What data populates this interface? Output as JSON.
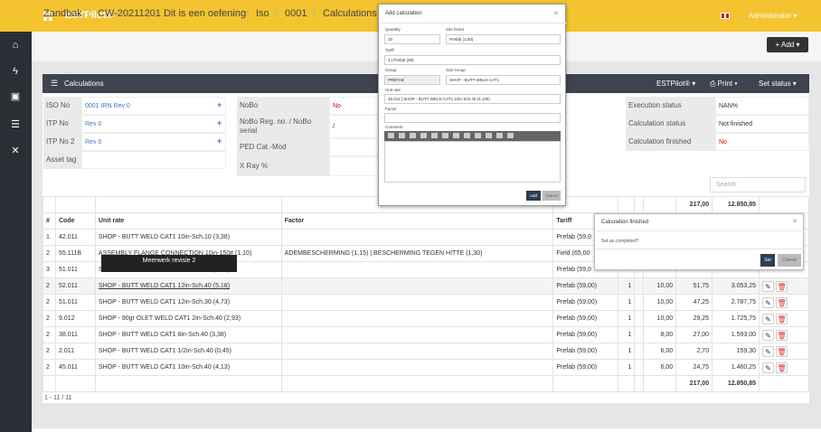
{
  "app": {
    "brand": "ESTPilot®",
    "user": "Administrator ▾"
  },
  "breadcrumb": [
    "Zandbak",
    "CW-20211201 Dit is een oefening",
    "Iso",
    "0001",
    "Calculations"
  ],
  "header": {
    "add_label": "+ Add ▾"
  },
  "panel": {
    "title": "Calculations",
    "menu_estpilot": "ESTPilot® ▾",
    "menu_print": "⎙ Print ▾",
    "menu_status": "Set status ▾"
  },
  "info": {
    "iso_no_label": "ISO No",
    "iso_no_value": "0001 IRN Rev 0",
    "itp_no_label": "ITP No",
    "itp_no_value": "Rev 0",
    "itp_no2_label": "ITP No 2",
    "itp_no2_value": "Rev 0",
    "asset_tag_label": "Asset tag",
    "nobo_label": "NoBo",
    "nobo_value": "No",
    "nobo_reg_label": "NoBo Reg. no. / NoBo serial",
    "nobo_reg_value": "/",
    "ped_label": "PED Cat.-Mod",
    "xray_label": "X Ray %",
    "exec_status_label": "Execution status",
    "exec_status_value": "NAN%",
    "calc_status_label": "Calculation status",
    "calc_status_value": "Not finished",
    "calc_finished_label": "Calculation finished",
    "calc_finished_value": "No"
  },
  "search": {
    "placeholder": "Search"
  },
  "table": {
    "headers": [
      "#",
      "Code",
      "Unit rate",
      "Factor",
      "Tariff"
    ],
    "total_hours": "217,00",
    "total_amount": "12.850,85",
    "rows": [
      {
        "n": "1",
        "code": "42.011",
        "unit": "SHOP - BUTT WELD CAT1 10in-Sch.10 (3,38)",
        "factor": "",
        "tariff": "Prefab (59,0",
        "q": "",
        "f": "",
        "h": "",
        "a": ""
      },
      {
        "n": "2",
        "code": "55.111B",
        "unit": "ASSEMBLY FLANGE CONNECTION 10in-150# (1,10)",
        "factor": "ADEMBESCHERMING (1,15) | BESCHERMING TEGEN HITTE (1,30)",
        "tariff": "Field (65,00",
        "q": "",
        "f": "",
        "h": "",
        "a": ""
      },
      {
        "n": "3",
        "code": "51.011",
        "unit": "SHOP - BUTT WELD CAT1 10in-Sch.40 (3,78)",
        "factor": "",
        "tariff": "Prefab (59,0",
        "q": "",
        "f": "",
        "h": "",
        "a": ""
      },
      {
        "n": "2",
        "code": "52.011",
        "unit": "SHOP - BUTT WELD CAT1 12in-Sch.40 (5,18)",
        "factor": "",
        "tariff": "Prefab (59,00)",
        "q": "1",
        "f": "10,00",
        "h": "51,75",
        "a": "3.053,25"
      },
      {
        "n": "2",
        "code": "51.011",
        "unit": "SHOP - BUTT WELD CAT1 12in-Sch.30 (4,73)",
        "factor": "",
        "tariff": "Prefab (59,00)",
        "q": "1",
        "f": "10,00",
        "h": "47,25",
        "a": "2.787,75"
      },
      {
        "n": "2",
        "code": "9.012",
        "unit": "SHOP - 90gr OLET WELD CAT1 2in-Sch.40 (2,93)",
        "factor": "",
        "tariff": "Prefab (59,00)",
        "q": "1",
        "f": "10,00",
        "h": "29,25",
        "a": "1.725,75"
      },
      {
        "n": "2",
        "code": "38.011",
        "unit": "SHOP - BUTT WELD CAT1 8in-Sch.40 (3,38)",
        "factor": "",
        "tariff": "Prefab (59,00)",
        "q": "1",
        "f": "8,00",
        "h": "27,00",
        "a": "1.593,00"
      },
      {
        "n": "2",
        "code": "2.011",
        "unit": "SHOP - BUTT WELD CAT1 1/2in-Sch.40 (0,45)",
        "factor": "",
        "tariff": "Prefab (59,00)",
        "q": "1",
        "f": "6,00",
        "h": "2,70",
        "a": "159,30"
      },
      {
        "n": "2",
        "code": "45.011",
        "unit": "SHOP - BUTT WELD CAT1 10in-Sch.40 (4,13)",
        "factor": "",
        "tariff": "Prefab (59,00)",
        "q": "1",
        "f": "6,00",
        "h": "24,75",
        "a": "1.460,25"
      }
    ]
  },
  "pager": "1 - 11 / 11",
  "tooltip": "Meerwerk revisie 2",
  "modal": {
    "title": "Add calculation",
    "quantity_label": "Quantity",
    "quantity_value": "10",
    "site_factor_label": "Site factor",
    "site_factor_value": "Prefab (1,00)",
    "tariff_label": "Tariff",
    "tariff_value": "1 | Prefab (59)",
    "group_label": "Group",
    "group_value": "PREFAB",
    "subgroup_label": "Sub Group",
    "subgroup_value": "SHOP - BUTT WELD CAT1",
    "unitrate_label": "Unit rate",
    "unitrate_value": "46.011 | SHOP - BUTT WELD CAT1 10in-Sch.40 (4,105)",
    "factor_label": "Factor",
    "comment_label": "Comment",
    "add_label": "Add",
    "cancel_label": "Cancel"
  },
  "dialog": {
    "title": "Calculation finished",
    "text": "Set as completed?",
    "set_label": "Set",
    "cancel_label": "Cancel"
  }
}
